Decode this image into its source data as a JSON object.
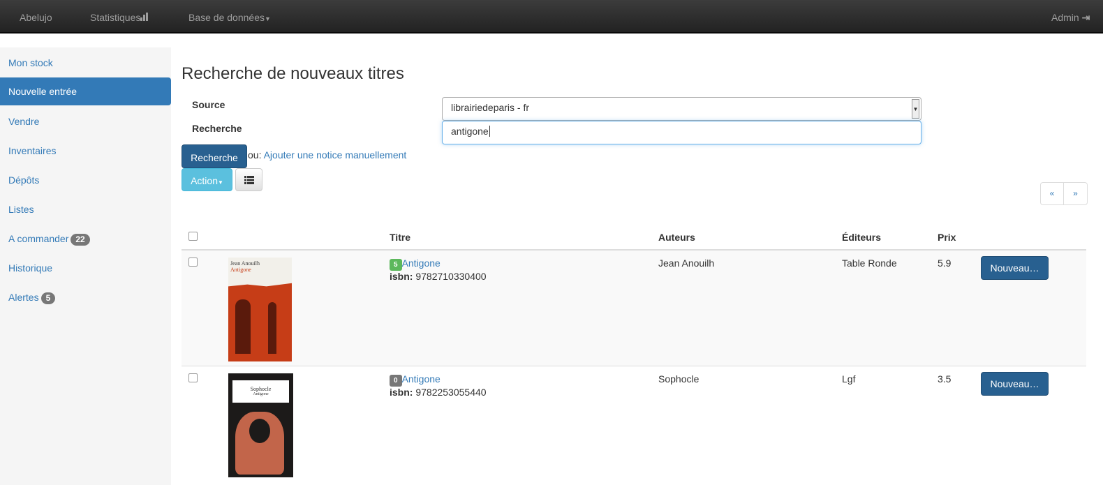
{
  "nav": {
    "brand": "Abelujo",
    "stats": "Statistiques",
    "db": "Base de données",
    "admin": "Admin"
  },
  "sidebar": {
    "items": [
      {
        "label": "Mon stock"
      },
      {
        "label": "Nouvelle entrée",
        "active": true
      },
      {
        "label": "Vendre"
      },
      {
        "label": "Inventaires"
      },
      {
        "label": "Dépôts"
      },
      {
        "label": "Listes"
      },
      {
        "label": "A commander",
        "badge": "22"
      },
      {
        "label": "Historique"
      },
      {
        "label": "Alertes",
        "badge": "5"
      }
    ]
  },
  "main": {
    "title": "Recherche de nouveaux titres",
    "source_label": "Source",
    "search_label": "Recherche",
    "source_value": "librairiedeparis - fr",
    "search_value": "antigone",
    "search_button": "Recherche",
    "or_text": "ou:",
    "manual_link": "Ajouter une notice manuellement",
    "action_button": "Action",
    "prev": "«",
    "next": "»"
  },
  "table": {
    "headers": [
      "Titre",
      "Auteurs",
      "Éditeurs",
      "Prix"
    ],
    "rows": [
      {
        "count": "5",
        "count_color": "#5cb85c",
        "title": "Antigone",
        "isbn_label": "isbn:",
        "isbn": "9782710330400",
        "author": "Jean Anouilh",
        "publisher": "Table Ronde",
        "price": "5.9",
        "button": "Nouveau…",
        "cover_author": "Jean Anouilh",
        "cover_title": "Antigone"
      },
      {
        "count": "0",
        "count_color": "#777777",
        "title": "Antigone",
        "isbn_label": "isbn:",
        "isbn": "9782253055440",
        "author": "Sophocle",
        "publisher": "Lgf",
        "price": "3.5",
        "button": "Nouveau…",
        "cover_author": "Sophocle",
        "cover_title": "Antigone"
      }
    ]
  },
  "colors": {
    "primary": "#337ab7",
    "info": "#5bc0de",
    "navbar": "#222222"
  }
}
